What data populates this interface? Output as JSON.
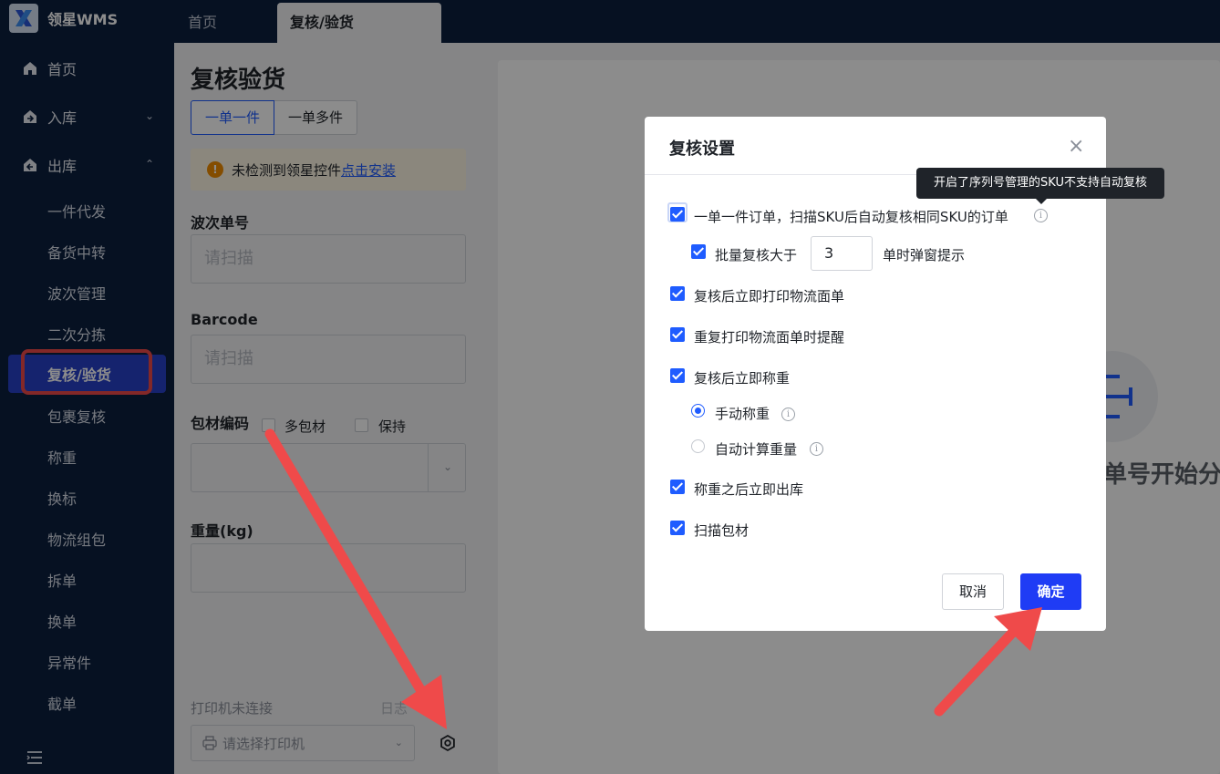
{
  "app": {
    "brand": "领星WMS"
  },
  "tabs": [
    {
      "label": "首页"
    },
    {
      "label": "复核/验货"
    }
  ],
  "sidebar": {
    "items": [
      {
        "label": "首页",
        "icon": "home-icon"
      },
      {
        "label": "入库",
        "icon": "inbound-icon"
      },
      {
        "label": "出库",
        "icon": "outbound-icon"
      }
    ],
    "sub_items": [
      "一件代发",
      "备货中转",
      "波次管理",
      "二次分拣",
      "复核/验货",
      "包裹复核",
      "称重",
      "换标",
      "物流组包",
      "拆单",
      "换单",
      "异常件",
      "截单"
    ]
  },
  "panel": {
    "title": "复核验货",
    "mode_single": "一单一件",
    "mode_multi": "一单多件",
    "warning_text": "未检测到领星控件",
    "warning_link": "点击安装",
    "wave_label": "波次单号",
    "wave_placeholder": "请扫描",
    "barcode_label": "Barcode",
    "barcode_placeholder": "请扫描",
    "pack_label": "包材编码",
    "multi_pack": "多包材",
    "keep": "保持",
    "weight_label": "重量(kg)",
    "printer_status": "打印机未连接",
    "log": "日志",
    "printer_placeholder": "请选择打印机"
  },
  "main": {
    "scan_hint": "单号开始分"
  },
  "modal": {
    "title": "复核设置",
    "close": "×",
    "tooltip": "开启了序列号管理的SKU不支持自动复核",
    "opt_auto_review": "一单一件订单，扫描SKU后自动复核相同SKU的订单",
    "opt_batch_prefix": "批量复核大于",
    "batch_value": "3",
    "opt_batch_suffix": "单时弹窗提示",
    "opt_print_label": "复核后立即打印物流面单",
    "opt_reprint_remind": "重复打印物流面单时提醒",
    "opt_weigh": "复核后立即称重",
    "opt_manual_weigh": "手动称重",
    "opt_auto_calc": "自动计算重量",
    "opt_ship_after_weigh": "称重之后立即出库",
    "opt_scan_pack": "扫描包材",
    "cancel": "取消",
    "confirm": "确定",
    "checked": {
      "auto_review": true,
      "batch": true,
      "print_label": true,
      "reprint_remind": true,
      "weigh": true,
      "ship_after_weigh": true,
      "scan_pack": true
    },
    "weigh_mode": "manual"
  },
  "colors": {
    "sidebar_bg": "#0c1f3f",
    "accent": "#1f5cff",
    "confirm_bg": "#1f3cf5",
    "annotation": "#ef4a4a"
  }
}
